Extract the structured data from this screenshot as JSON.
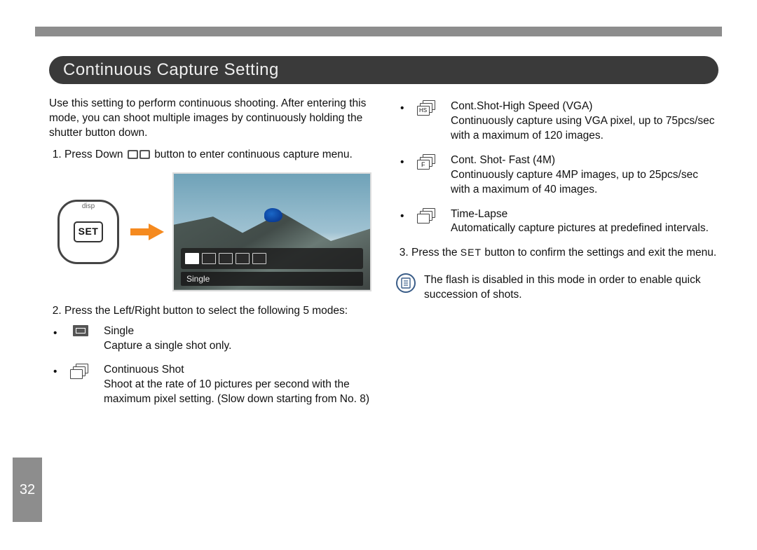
{
  "page_number": "32",
  "section_title": "Continuous Capture Setting",
  "intro": "Use this setting to perform continuous shooting. After entering this mode, you can shoot multiple images by continuously holding the shutter button down.",
  "step1_a": "Press Down",
  "step1_b": "button to enter continuous capture menu.",
  "controller": {
    "set": "SET",
    "disp": "disp"
  },
  "preview_label": "Single",
  "step2": "Press the Left/Right button to select the following 5 modes:",
  "modes_left": [
    {
      "title": "Single",
      "desc": "Capture a single shot only."
    },
    {
      "title": "Continuous Shot",
      "desc": "Shoot at the rate of 10 pictures per second with the maximum pixel setting. (Slow down starting from No. 8)"
    }
  ],
  "modes_right": [
    {
      "title": "Cont.Shot-High Speed (VGA)",
      "desc": "Continuously capture using VGA pixel, up to 75pcs/sec with a maximum of 120 images."
    },
    {
      "title": "Cont. Shot- Fast (4M)",
      "desc": "Continuously capture 4MP images, up to 25pcs/sec with a maximum of 40 images."
    },
    {
      "title": "Time-Lapse",
      "desc": "Automatically capture pictures at predefined intervals."
    }
  ],
  "step3_a": "Press the",
  "step3_set": "SET",
  "step3_b": "button to confirm the settings and exit the menu.",
  "note": "The flash is disabled in this mode in order to enable quick succession of shots."
}
